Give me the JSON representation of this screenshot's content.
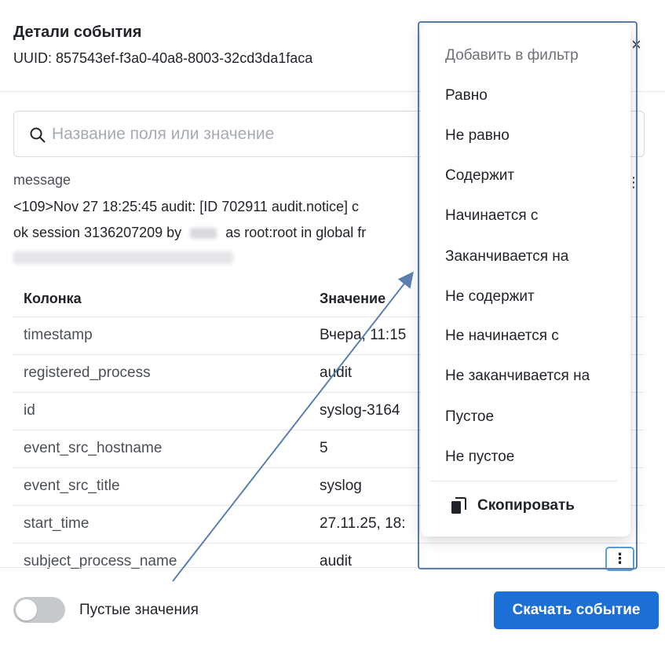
{
  "header": {
    "title": "Детали события",
    "uuid": "UUID: 857543ef-f3a0-40a8-8003-32cd3da1faca",
    "close_icon": "×"
  },
  "search": {
    "placeholder": "Название поля или значение"
  },
  "message": {
    "label": "message",
    "line1": "<109>Nov 27 18:25:45 audit: [ID 702911 audit.notice] c",
    "line2_before": "ok session 3136207209 by",
    "line2_after": "as root:root in global fr"
  },
  "table": {
    "headers": {
      "column": "Колонка",
      "value": "Значение"
    },
    "rows": [
      {
        "key": "timestamp",
        "value": "Вчера, 11:15"
      },
      {
        "key": "registered_process",
        "value": "audit"
      },
      {
        "key": "id",
        "value": "syslog-3164"
      },
      {
        "key": "event_src_hostname",
        "value": "5"
      },
      {
        "key": "event_src_title",
        "value": "syslog"
      },
      {
        "key": "start_time",
        "value": "27.11.25, 18:"
      },
      {
        "key": "subject_process_name",
        "value": "audit"
      }
    ]
  },
  "menu": {
    "title": "Добавить в фильтр",
    "items": [
      "Равно",
      "Не равно",
      "Содержит",
      "Начинается с",
      "Заканчивается на",
      "Не содержит",
      "Не начинается с",
      "Не заканчивается на",
      "Пустое",
      "Не пустое"
    ],
    "copy": "Скопировать"
  },
  "footer": {
    "toggle_label": "Пустые значения",
    "download": "Скачать событие"
  },
  "colors": {
    "accent": "#1b6fd6",
    "annotation": "#5a7fb0"
  }
}
